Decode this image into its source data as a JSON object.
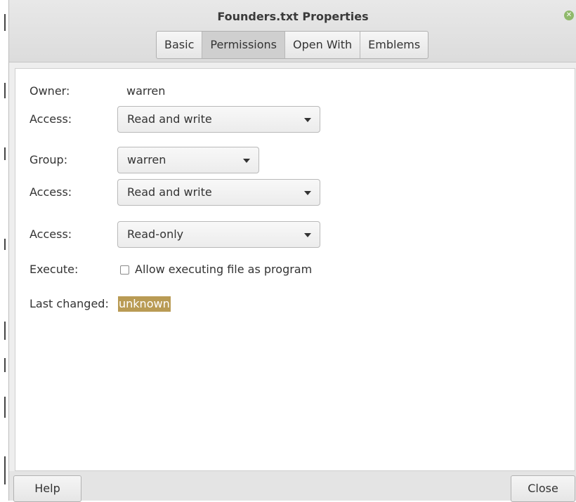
{
  "window": {
    "title": "Founders.txt Properties"
  },
  "tabs": [
    {
      "label": "Basic"
    },
    {
      "label": "Permissions",
      "active": true
    },
    {
      "label": "Open With"
    },
    {
      "label": "Emblems"
    }
  ],
  "permissions": {
    "owner_label": "Owner:",
    "owner_value": "warren",
    "owner_access_label": "Access:",
    "owner_access_value": "Read and write",
    "group_label": "Group:",
    "group_value": "warren",
    "group_access_label": "Access:",
    "group_access_value": "Read and write",
    "others_access_label": "Access:",
    "others_access_value": "Read-only",
    "execute_label": "Execute:",
    "execute_checkbox_label": "Allow executing file as program",
    "execute_checked": false,
    "last_changed_label": "Last changed:",
    "last_changed_value": "unknown"
  },
  "footer": {
    "help_label": "Help",
    "close_label": "Close"
  },
  "colors": {
    "highlight": "#b99b54",
    "close_icon": "#8fb96a"
  },
  "icons": {
    "window_close": "close-icon",
    "dropdown": "chevron-down-icon"
  }
}
